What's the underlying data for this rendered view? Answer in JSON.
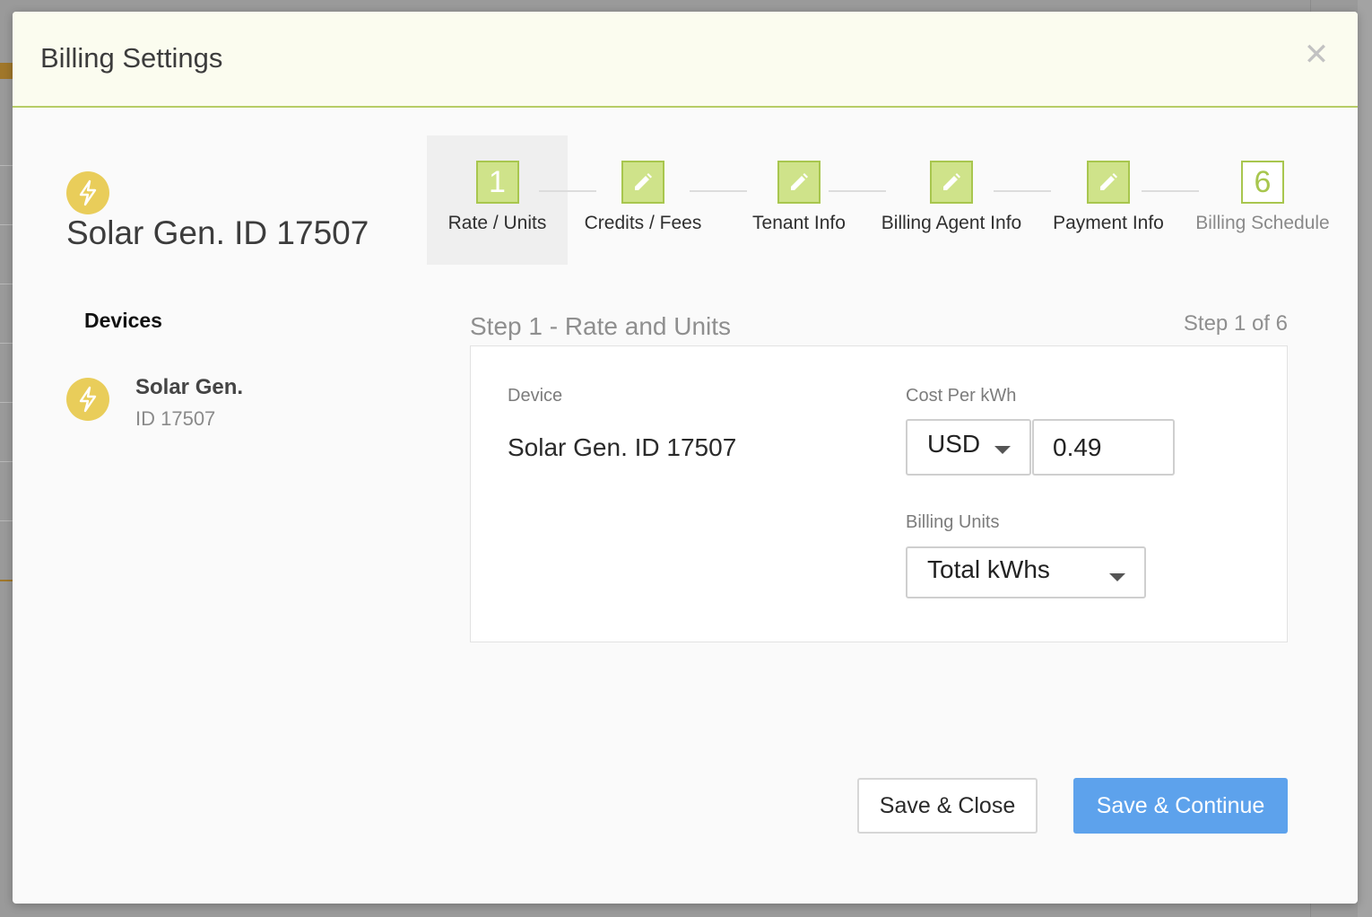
{
  "modal": {
    "title": "Billing Settings",
    "close_symbol": "✕"
  },
  "device_header": {
    "icon": "bolt-icon",
    "title": "Solar Gen. ID 17507"
  },
  "steps": [
    {
      "marker": "1",
      "label": "Rate / Units",
      "state": "active"
    },
    {
      "marker": "pencil-icon",
      "label": "Credits / Fees",
      "state": "completed"
    },
    {
      "marker": "pencil-icon",
      "label": "Tenant Info",
      "state": "completed"
    },
    {
      "marker": "pencil-icon",
      "label": "Billing Agent Info",
      "state": "completed"
    },
    {
      "marker": "pencil-icon",
      "label": "Payment Info",
      "state": "completed"
    },
    {
      "marker": "6",
      "label": "Billing Schedule",
      "state": "pending"
    }
  ],
  "sidebar": {
    "heading": "Devices",
    "items": [
      {
        "icon": "bolt-icon",
        "name": "Solar Gen.",
        "id": "ID 17507"
      }
    ]
  },
  "form": {
    "heading": "Step 1 - Rate and Units",
    "step_count": "Step 1 of 6",
    "device_label": "Device",
    "device_value": "Solar Gen. ID 17507",
    "cost_label": "Cost Per kWh",
    "currency": "USD",
    "cost_value": "0.49",
    "units_label": "Billing Units",
    "units_value": "Total kWhs"
  },
  "buttons": {
    "save_close": "Save & Close",
    "save_continue": "Save & Continue"
  },
  "colors": {
    "accent_green": "#a8c64e",
    "step_fill": "#cfe38a",
    "primary_blue": "#5da2ec",
    "icon_yellow": "#e9cd5a",
    "header_bg": "#fbfcef"
  }
}
